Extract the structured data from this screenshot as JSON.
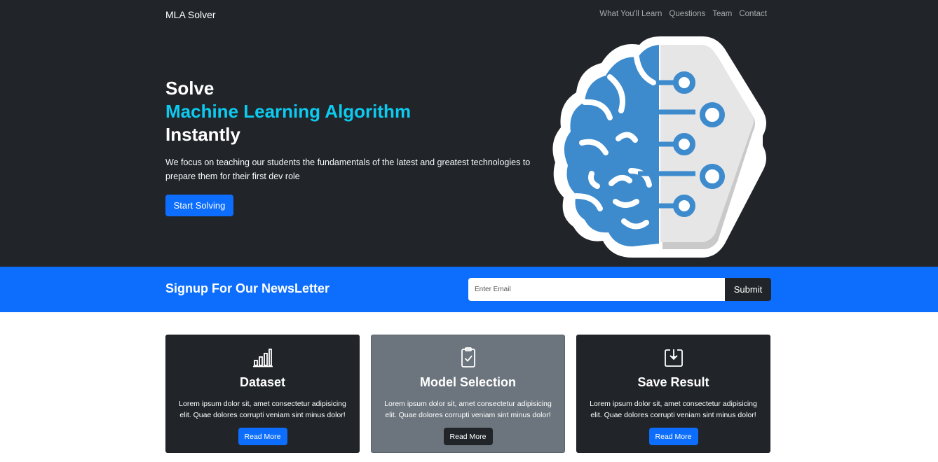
{
  "navbar": {
    "brand": "MLA Solver",
    "links": [
      "What You'll Learn",
      "Questions",
      "Team",
      "Contact"
    ]
  },
  "hero": {
    "title_line1": "Solve",
    "title_line2": "Machine Learning Algorithm",
    "title_line3": "Instantly",
    "description": "We focus on teaching our students the fundamentals of the latest and greatest technologies to prepare them for their first dev role",
    "button_label": "Start Solving",
    "image_icon": "brain-circuit-icon"
  },
  "newsletter": {
    "title": "Signup For Our NewsLetter",
    "email_placeholder": "Enter Email",
    "email_value": "",
    "submit_label": "Submit"
  },
  "cards": [
    {
      "icon": "bar-chart-icon",
      "title": "Dataset",
      "text": "Lorem ipsum dolor sit, amet consectetur adipisicing elit. Quae dolores corrupti veniam sint minus dolor!",
      "button_label": "Read More"
    },
    {
      "icon": "clipboard-check-icon",
      "title": "Model Selection",
      "text": "Lorem ipsum dolor sit, amet consectetur adipisicing elit. Quae dolores corrupti veniam sint minus dolor!",
      "button_label": "Read More"
    },
    {
      "icon": "download-box-icon",
      "title": "Save Result",
      "text": "Lorem ipsum dolor sit, amet consectetur adipisicing elit. Quae dolores corrupti veniam sint minus dolor!",
      "button_label": "Read More"
    }
  ],
  "colors": {
    "dark": "#212529",
    "primary": "#0d6efd",
    "info": "#0dcaf0",
    "secondary": "#6c757d",
    "brain_blue": "#3d8bcd"
  }
}
